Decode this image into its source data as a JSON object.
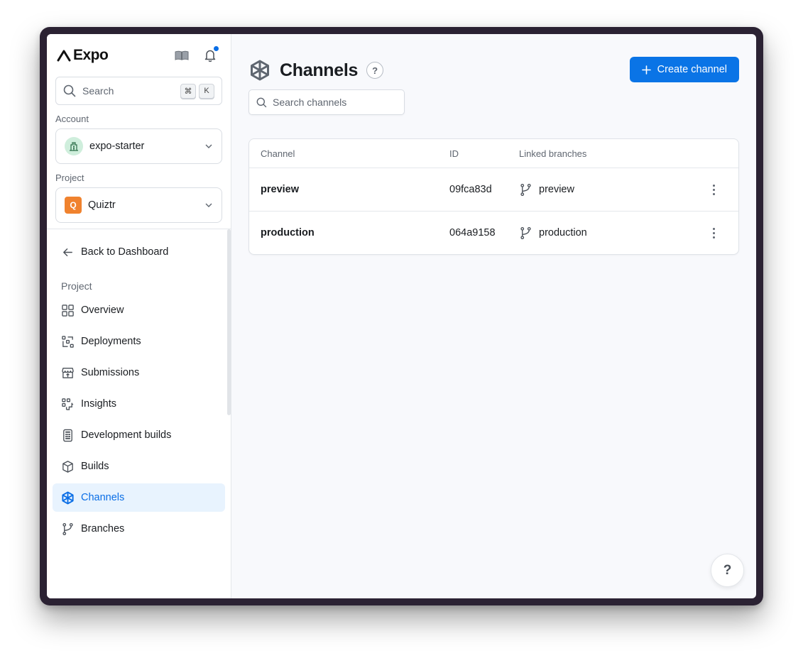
{
  "app": {
    "brand": "Expo"
  },
  "sidebar": {
    "search": {
      "label": "Search",
      "shortcut_keys": [
        "⌘",
        "K"
      ]
    },
    "account": {
      "label": "Account",
      "value": "expo-starter"
    },
    "project": {
      "label": "Project",
      "value": "Quiztr",
      "avatar_letter": "Q",
      "avatar_color": "#f0822e"
    },
    "back_label": "Back to Dashboard",
    "section_label": "Project",
    "items": [
      {
        "label": "Overview",
        "icon": "grid-icon"
      },
      {
        "label": "Deployments",
        "icon": "deployments-icon"
      },
      {
        "label": "Submissions",
        "icon": "store-upload-icon"
      },
      {
        "label": "Insights",
        "icon": "insights-icon"
      },
      {
        "label": "Development builds",
        "icon": "device-icon"
      },
      {
        "label": "Builds",
        "icon": "cube-icon"
      },
      {
        "label": "Channels",
        "icon": "hexagon-channels-icon",
        "active": true
      },
      {
        "label": "Branches",
        "icon": "branch-icon"
      }
    ]
  },
  "main": {
    "title": "Channels",
    "help": "?",
    "create_button": "Create channel",
    "search_placeholder": "Search channels",
    "table": {
      "columns": [
        "Channel",
        "ID",
        "Linked branches"
      ],
      "rows": [
        {
          "channel": "preview",
          "id": "09fca83d",
          "branch": "preview"
        },
        {
          "channel": "production",
          "id": "064a9158",
          "branch": "production"
        }
      ]
    },
    "floating_help": "?"
  },
  "colors": {
    "accent": "#0a74e6",
    "active_bg": "#e8f3fe",
    "notification": "#0a6ee6"
  }
}
